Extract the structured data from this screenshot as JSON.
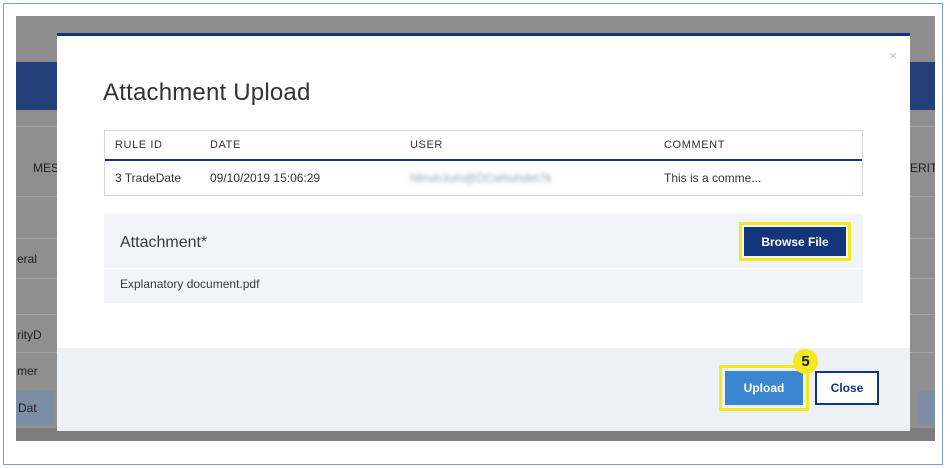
{
  "background": {
    "fragments": {
      "left_header": "MES",
      "right_header": "ERIT",
      "left_row1": "eral",
      "left_row2": "rityD",
      "left_row3": "mer",
      "left_row4": "Dat"
    }
  },
  "modal": {
    "title": "Attachment Upload",
    "close_glyph": "×",
    "table": {
      "headers": [
        "RULE ID",
        "DATE",
        "USER",
        "COMMENT"
      ],
      "rows": [
        {
          "rule_id": "3 TradeDate",
          "date": "09/10/2019 15:06:29",
          "user": "hllnvirJum@DCwhuhdet7k",
          "comment": "This is a comme..."
        }
      ]
    },
    "attachment": {
      "label": "Attachment*",
      "browse_label": "Browse File",
      "file_name": "Explanatory document.pdf"
    },
    "footer": {
      "upload_label": "Upload",
      "close_label": "Close",
      "step_number": "5"
    }
  },
  "colors": {
    "primary": "#13357a",
    "upload_blue": "#3a86d1",
    "highlight": "#f2ea1f",
    "overlay": "#8f8f8f"
  }
}
